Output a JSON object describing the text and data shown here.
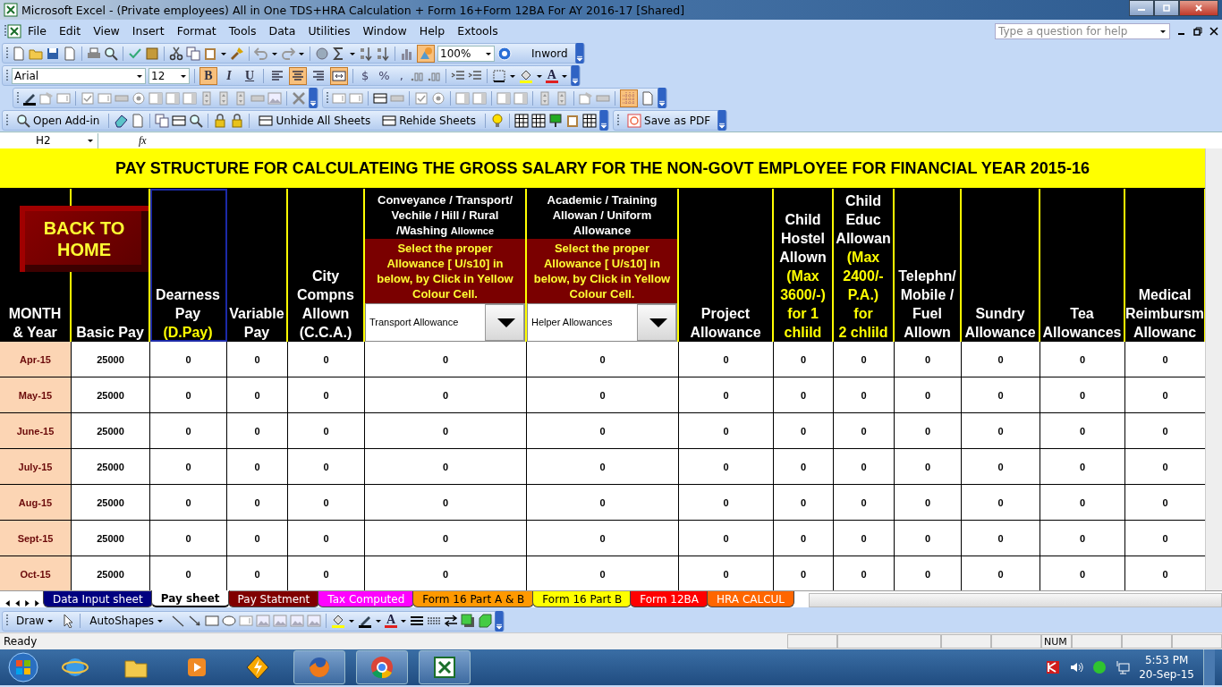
{
  "window": {
    "title": "Microsoft Excel - (Private employees)  All in One TDS+HRA Calculation + Form 16+Form 12BA For AY 2016-17  [Shared]"
  },
  "menu": [
    "File",
    "Edit",
    "View",
    "Insert",
    "Format",
    "Tools",
    "Data",
    "Utilities",
    "Window",
    "Help",
    "Extools"
  ],
  "help_box": {
    "placeholder": "Type a question for help"
  },
  "standard_toolbar": {
    "zoom": "100%",
    "button": "Inword",
    "drawing_toggle": {
      "selected": true
    }
  },
  "formatting_toolbar": {
    "font": "Arial",
    "size": "12",
    "style_buttons": [
      {
        "label": "B",
        "selected": true
      },
      {
        "label": "I",
        "selected": false
      },
      {
        "label": "U",
        "selected": false
      }
    ],
    "align_buttons": [
      {
        "kind": "left",
        "selected": false
      },
      {
        "kind": "center",
        "selected": true
      },
      {
        "kind": "right",
        "selected": false
      },
      {
        "kind": "merge",
        "selected": true
      }
    ],
    "number_buttons": [
      "$",
      "%",
      ","
    ],
    "font_color_label": "A"
  },
  "forms_toolbar": {
    "grid_toggle": {
      "selected": true
    }
  },
  "addin_toolbar": {
    "buttons": [
      "Open Add-in",
      "Unhide All Sheets",
      "Rehide Sheets"
    ],
    "pdf_button": "Save as PDF"
  },
  "formula_bar": {
    "name_box": "H2",
    "formula_label": "fx"
  },
  "sheet": {
    "title": "PAY STRUCTURE FOR CALCULATEING THE GROSS SALARY FOR THE NON-GOVT EMPLOYEE FOR FINANCIAL YEAR 2015-16",
    "back_button": "BACK TO\nHOME",
    "columns": [
      {
        "kind": "plain",
        "heading": "MONTH\n& Year",
        "selected": false
      },
      {
        "kind": "plain",
        "heading": "Basic Pay",
        "selected": false
      },
      {
        "kind": "plain",
        "heading": "Dearness\nPay",
        "note": "(D.Pay)",
        "selected": true
      },
      {
        "kind": "plain",
        "heading": "Variable\nPay",
        "selected": false
      },
      {
        "kind": "plain",
        "heading": "City\nCompns\nAllown\n(C.C.A.)",
        "selected": false
      },
      {
        "kind": "choice",
        "heading": "Conveyance / Transport/\nVechile / Hill / Rural\n/Washing",
        "heading_small": "Allownce",
        "instruction": "Select the proper\nAllowance [ U/s10] in\nbelow, by Click in Yellow\nColour Cell.",
        "choice": "Transport Allowance",
        "selected": false
      },
      {
        "kind": "choice",
        "heading": "Academic / Training\nAllowan / Uniform\nAllowance",
        "instruction": "Select the proper\nAllowance [ U/s10] in\nbelow, by Click in Yellow\nColour Cell.",
        "choice": "Helper Allowances",
        "selected": false
      },
      {
        "kind": "plain",
        "heading": "Project\nAllowance",
        "selected": false
      },
      {
        "kind": "plain",
        "heading": "Child\nHostel\nAllown",
        "note": "(Max\n3600/-)\nfor 1\nchlild",
        "selected": false
      },
      {
        "kind": "plain",
        "heading": "Child\nEduc\nAllowan",
        "note": "(Max\n2400/-\nP.A.)\nfor\n2 chlild",
        "selected": false
      },
      {
        "kind": "plain",
        "heading": "Telephn/\nMobile /\nFuel\nAllown",
        "selected": false
      },
      {
        "kind": "plain",
        "heading": "Sundry\nAllowance",
        "selected": false
      },
      {
        "kind": "plain",
        "heading": "Tea\nAllowances",
        "selected": false
      },
      {
        "kind": "plain",
        "heading": "Medical\nReimbursm\nAllowanc",
        "selected": false
      }
    ],
    "rows": [
      {
        "cells": [
          "Apr-15",
          "25000",
          "0",
          "0",
          "0",
          "0",
          "0",
          "0",
          "0",
          "0",
          "0",
          "0",
          "0",
          "0"
        ]
      },
      {
        "cells": [
          "May-15",
          "25000",
          "0",
          "0",
          "0",
          "0",
          "0",
          "0",
          "0",
          "0",
          "0",
          "0",
          "0",
          "0"
        ]
      },
      {
        "cells": [
          "June-15",
          "25000",
          "0",
          "0",
          "0",
          "0",
          "0",
          "0",
          "0",
          "0",
          "0",
          "0",
          "0",
          "0"
        ]
      },
      {
        "cells": [
          "July-15",
          "25000",
          "0",
          "0",
          "0",
          "0",
          "0",
          "0",
          "0",
          "0",
          "0",
          "0",
          "0",
          "0"
        ]
      },
      {
        "cells": [
          "Aug-15",
          "25000",
          "0",
          "0",
          "0",
          "0",
          "0",
          "0",
          "0",
          "0",
          "0",
          "0",
          "0",
          "0"
        ]
      },
      {
        "cells": [
          "Sept-15",
          "25000",
          "0",
          "0",
          "0",
          "0",
          "0",
          "0",
          "0",
          "0",
          "0",
          "0",
          "0",
          "0"
        ]
      },
      {
        "cells": [
          "Oct-15",
          "25000",
          "0",
          "0",
          "0",
          "0",
          "0",
          "0",
          "0",
          "0",
          "0",
          "0",
          "0",
          "0"
        ]
      }
    ]
  },
  "sheet_tabs": [
    {
      "label": "Data Input sheet",
      "color": "#000080",
      "selected": false
    },
    {
      "label": "Pay sheet",
      "color": "#ffffff",
      "selected": true
    },
    {
      "label": "Pay Statment",
      "color": "#800000",
      "selected": false
    },
    {
      "label": "Tax Computed",
      "color": "#ff00ff",
      "selected": false
    },
    {
      "label": "Form 16 Part A & B",
      "color": "#ff9900",
      "selected": false
    },
    {
      "label": "Form 16 Part B",
      "color": "#ffff00",
      "selected": false
    },
    {
      "label": "Form 12BA",
      "color": "#ff0000",
      "selected": false
    },
    {
      "label": "HRA CALCUL",
      "color": "#ff6600",
      "selected": false
    }
  ],
  "drawing_toolbar": {
    "buttons": [
      "Draw",
      "AutoShapes"
    ],
    "font_color_label": "A"
  },
  "status_bar": {
    "text": "Ready",
    "indicators": [
      "NUM"
    ]
  },
  "taskbar": {
    "time": "5:53 PM",
    "date": "20-Sep-15"
  }
}
